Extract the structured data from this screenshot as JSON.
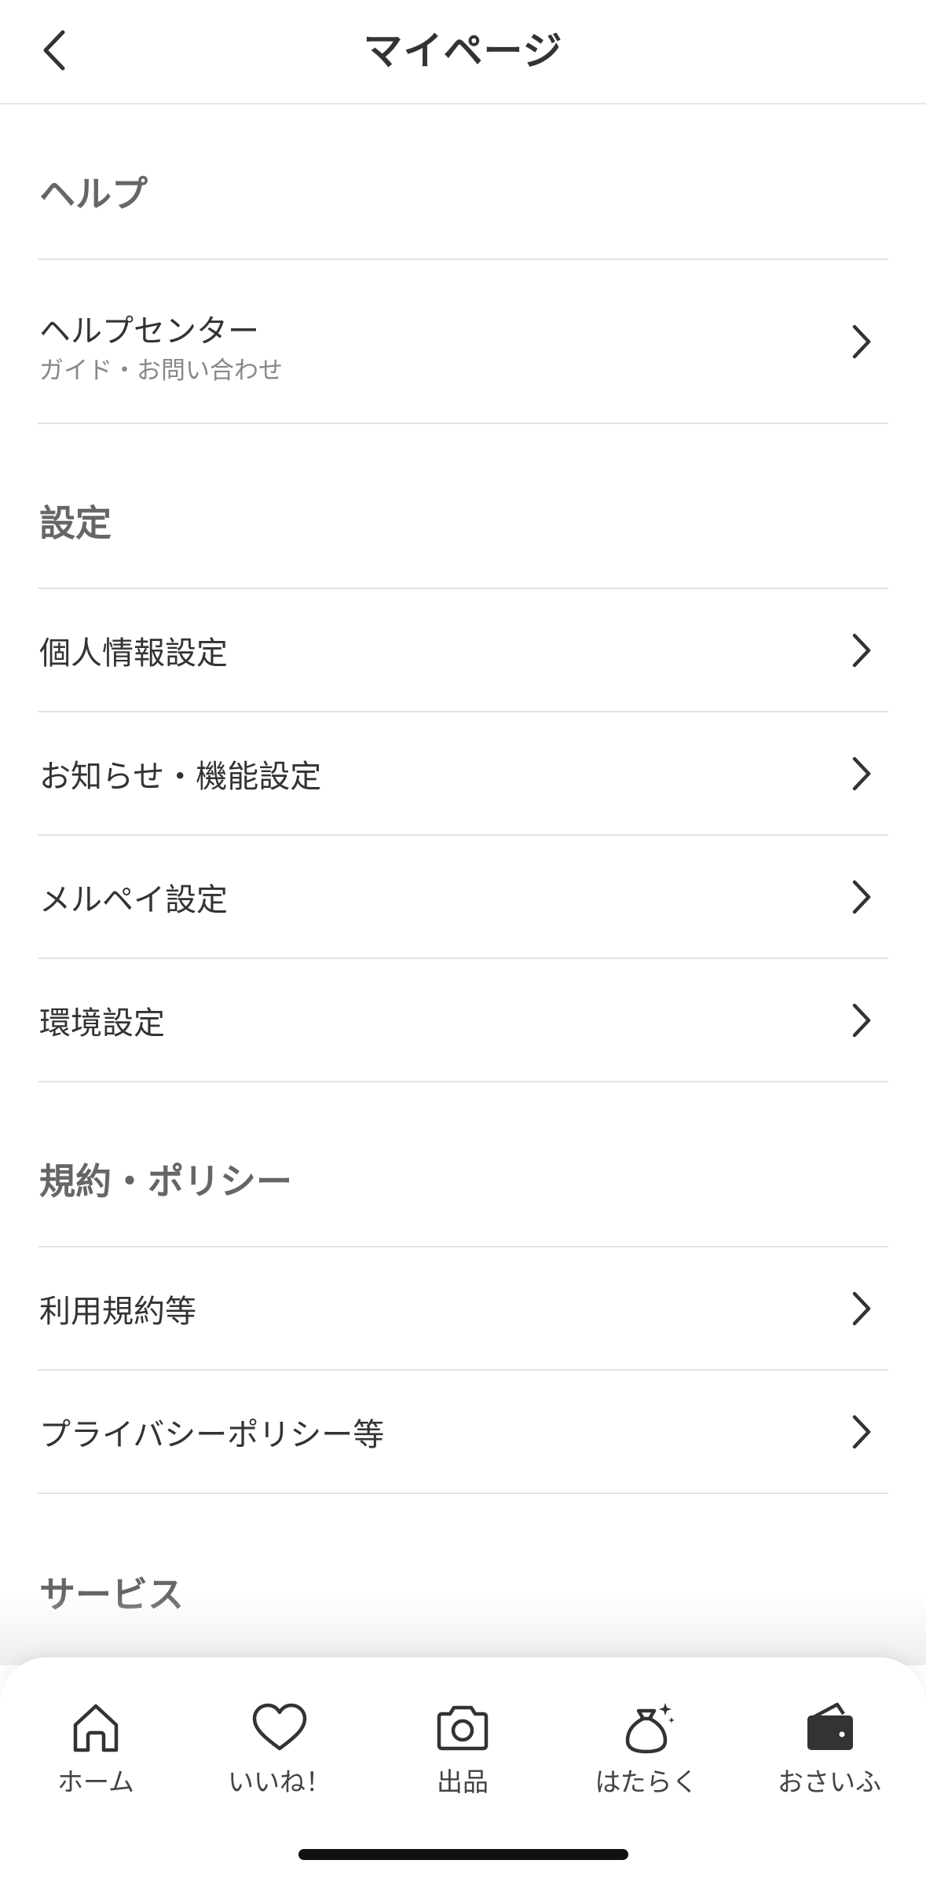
{
  "header": {
    "title": "マイページ",
    "back_icon": "chevron-left-icon"
  },
  "sections": [
    {
      "title": "ヘルプ",
      "items": [
        {
          "label": "ヘルプセンター",
          "sub": "ガイド・お問い合わせ"
        }
      ]
    },
    {
      "title": "設定",
      "items": [
        {
          "label": "個人情報設定"
        },
        {
          "label": "お知らせ・機能設定"
        },
        {
          "label": "メルペイ設定"
        },
        {
          "label": "環境設定"
        }
      ]
    },
    {
      "title": "規約・ポリシー",
      "items": [
        {
          "label": "利用規約等"
        },
        {
          "label": "プライバシーポリシー等"
        }
      ]
    },
    {
      "title": "サービス",
      "items": []
    }
  ],
  "bottom_nav": [
    {
      "label": "ホーム",
      "icon": "home-icon"
    },
    {
      "label": "いいね！",
      "icon": "heart-icon"
    },
    {
      "label": "出品",
      "icon": "camera-icon"
    },
    {
      "label": "はたらく",
      "icon": "money-bag-icon"
    },
    {
      "label": "おさいふ",
      "icon": "wallet-icon"
    }
  ],
  "colors": {
    "text": "#333333",
    "section_title": "#666666",
    "subtext": "#888888",
    "divider": "#e3e3e3"
  }
}
